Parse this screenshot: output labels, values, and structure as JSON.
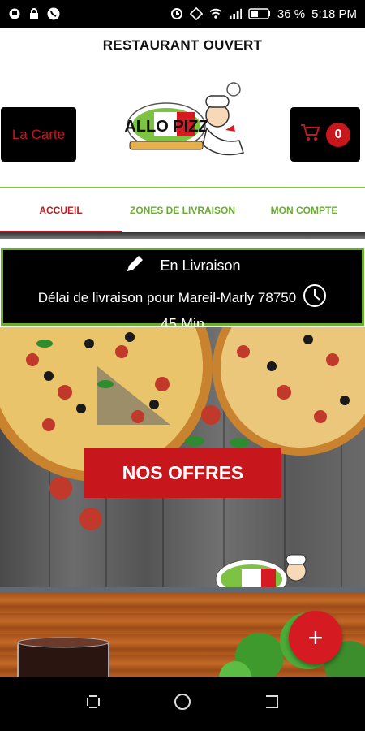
{
  "status_bar": {
    "battery": "36 %",
    "time": "5:18 PM",
    "icons_left": [
      "message-icon",
      "lock-icon",
      "whatsapp-icon"
    ],
    "icons_right": [
      "data-saver-icon",
      "rotate-icon",
      "wifi-icon",
      "signal-icon",
      "battery-icon"
    ]
  },
  "header": {
    "restaurant_status": "RESTAURANT OUVERT",
    "menu_button_label": "La Carte",
    "cart_count": "0",
    "logo_text": "ALLO PIZZ"
  },
  "tabs": [
    {
      "label": "ACCUEIL",
      "active": true
    },
    {
      "label": "ZONES DE LIVRAISON",
      "active": false
    },
    {
      "label": "MON COMPTE",
      "active": false
    }
  ],
  "delivery": {
    "mode": "En Livraison",
    "delay_text": "Délai de livraison pour Mareil-Marly 78750",
    "duration": "45 Min"
  },
  "hero": {
    "offers_button_label": "NOS OFFRES"
  },
  "fab": {
    "icon": "plus-icon",
    "label": "+"
  },
  "colors": {
    "brand_red": "#c8161d",
    "brand_green": "#6aae2e",
    "dark": "#000000"
  }
}
